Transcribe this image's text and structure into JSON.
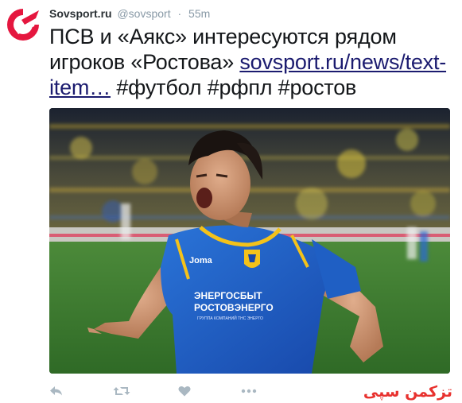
{
  "account": {
    "name": "Sovsport.ru",
    "handle": "@sovsport",
    "separator": "·",
    "time": "55m",
    "avatar_icon": "sovsport-logo-icon"
  },
  "tweet": {
    "text_before": "ПСВ и «Аякс» интересуются рядом игроков «Ростова» ",
    "link": "sovsport.ru/news/text-item…",
    "hashtags": [
      "#футбол",
      "#рфпл",
      "#ростов"
    ]
  },
  "media": {
    "kit": {
      "brand": "Joma",
      "sponsor_line1": "ЭНЕРГОСБЫТ",
      "sponsor_line2": "РОСТОВЭНЕРГО",
      "sponsor_small": "ГРУППА КОМПАНИЙ ТНС ЭНЕРГО"
    }
  },
  "actions": {
    "reply_icon": "reply-icon",
    "retweet_icon": "retweet-icon",
    "like_icon": "heart-icon",
    "more_icon": "more-icon"
  },
  "watermark": "تزکمن سپی",
  "colors": {
    "link": "#1b1b6f",
    "text": "#14171a",
    "secondary": "#8899a6",
    "brand_red": "#e5173f",
    "jersey": "#1f5fc4",
    "jersey_trim": "#f4c21a"
  }
}
